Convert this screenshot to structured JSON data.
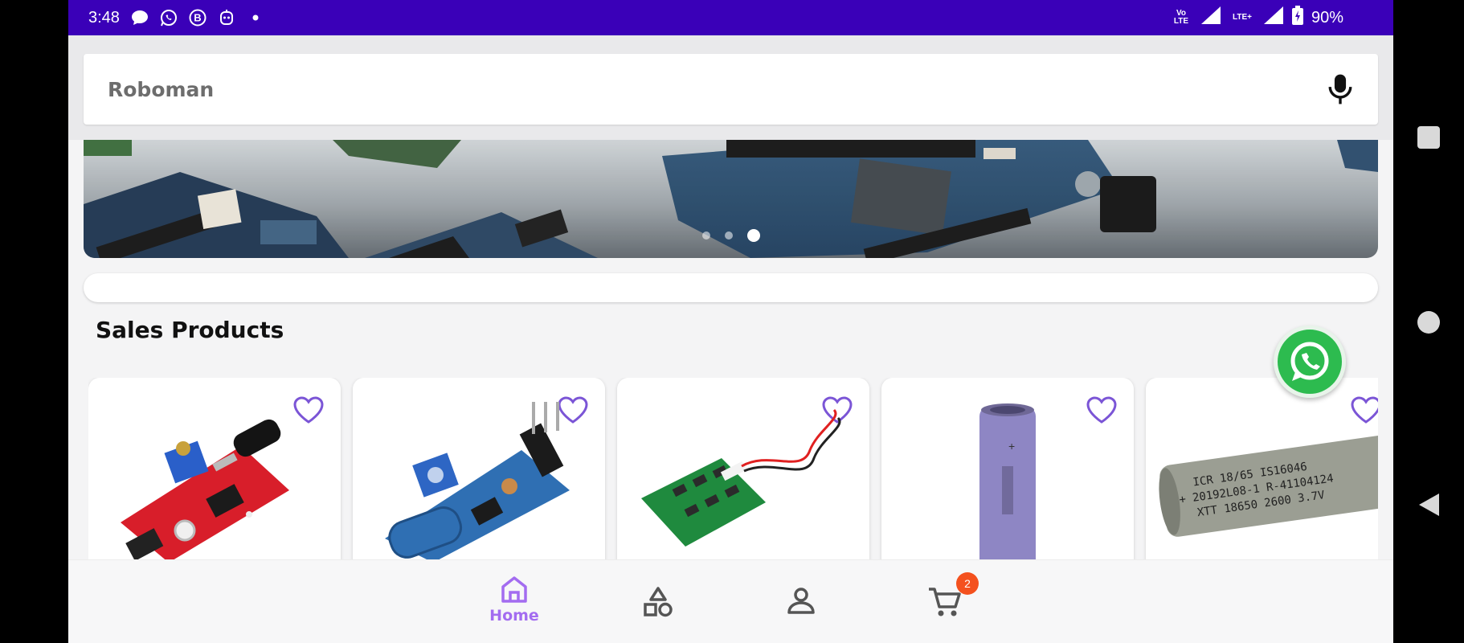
{
  "status_bar": {
    "time": "3:48",
    "network_label": "Vo LTE",
    "network2_label": "LTE+",
    "battery": "90%",
    "icons": [
      "chat-bubble-icon",
      "whatsapp-icon",
      "b-app-icon",
      "robot-icon",
      "dot-icon",
      "signal-icon",
      "battery-icon"
    ]
  },
  "search": {
    "text": "Roboman",
    "mic_icon": "mic-icon"
  },
  "banner": {
    "slide_count": 3,
    "active_slide": 3
  },
  "section": {
    "title": "Sales Products"
  },
  "products": [
    {
      "image": "flame-sensor-module",
      "favorite_icon": "heart-outline-icon"
    },
    {
      "image": "vibration-sensor-module",
      "favorite_icon": "heart-outline-icon"
    },
    {
      "image": "bms-protection-board",
      "favorite_icon": "heart-outline-icon"
    },
    {
      "image": "purple-18650-battery",
      "favorite_icon": "heart-outline-icon"
    },
    {
      "image": "grey-18650-battery",
      "favorite_icon": "heart-outline-icon"
    }
  ],
  "battery_print": {
    "line1": "ICR 18/65   IS16046",
    "line2": "+ 20192L08-1   R-41104124",
    "line3": "XTT 18650 2600 3.7V"
  },
  "bottom_nav": {
    "items": [
      {
        "label": "Home",
        "icon": "home-icon",
        "active": true
      },
      {
        "label": "",
        "icon": "categories-icon",
        "active": false
      },
      {
        "label": "",
        "icon": "profile-icon",
        "active": false
      },
      {
        "label": "",
        "icon": "cart-icon",
        "active": false
      }
    ],
    "cart_badge": "2"
  },
  "colors": {
    "status_bar": "#3a00b8",
    "accent": "#a36cf0",
    "heart": "#7b55d6",
    "badge": "#f4511e",
    "whatsapp": "#2dbb4f"
  }
}
